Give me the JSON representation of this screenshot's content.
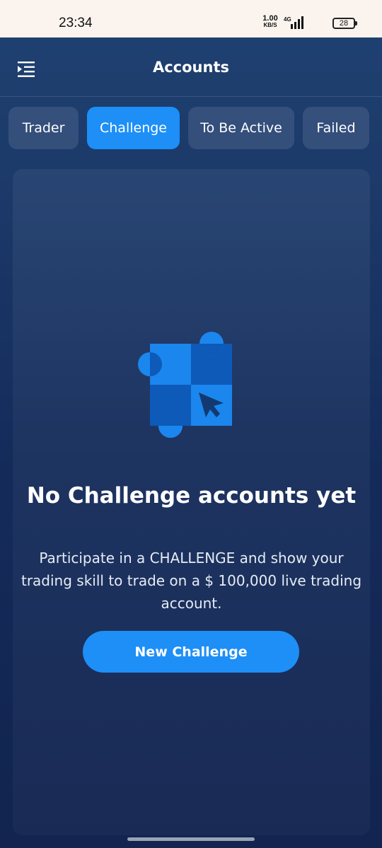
{
  "status_bar": {
    "time": "23:34",
    "net_speed_value": "1.00",
    "net_speed_unit": "KB/S",
    "network": "4G",
    "battery": "28"
  },
  "header": {
    "title": "Accounts",
    "menu_icon": "menu-collapse-icon"
  },
  "tabs": [
    {
      "label": "Trader",
      "active": false
    },
    {
      "label": "Challenge",
      "active": true
    },
    {
      "label": "To Be Active",
      "active": false
    },
    {
      "label": "Failed",
      "active": false
    }
  ],
  "empty_state": {
    "illustration_icon": "puzzle-cursor-icon",
    "title": "No Challenge accounts yet",
    "description": "Participate in a CHALLENGE and show your trading skill to trade on a $ 100,000 live trading account.",
    "button_label": "New Challenge"
  },
  "colors": {
    "accent": "#1d8ff7",
    "background_top": "#1f4272",
    "background_bottom": "#12244f",
    "status_bar": "#fbf4ee"
  }
}
